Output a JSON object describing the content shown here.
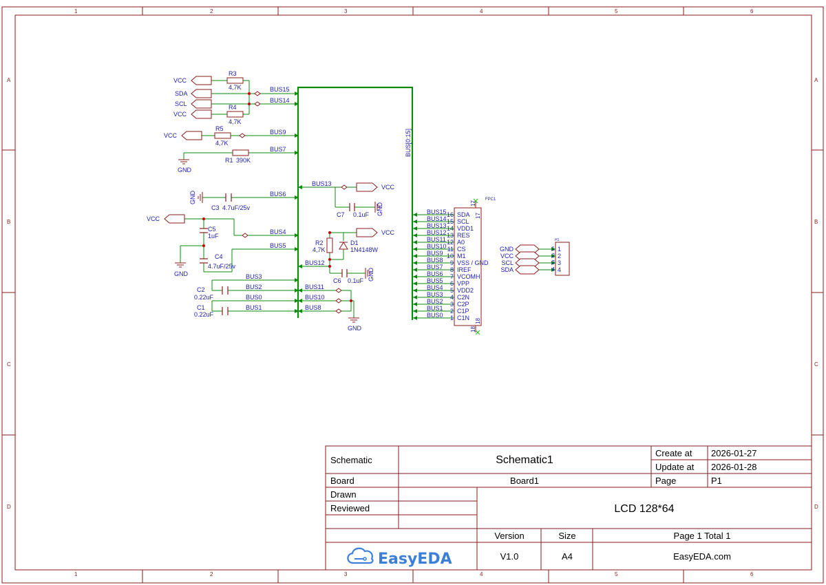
{
  "colors": {
    "border": "#8b1a1a",
    "wire": "#0a8a0a",
    "component": "#8b1a1a",
    "text": "#1c1cb0",
    "junction": "#c00000",
    "logo": "#3c7fd8"
  },
  "frame": {
    "columns": [
      "1",
      "2",
      "3",
      "4",
      "5",
      "6"
    ],
    "rows": [
      "A",
      "B",
      "C",
      "D"
    ]
  },
  "bus": {
    "label": "BUS[0:15]"
  },
  "left_circuit": {
    "ports": {
      "vcc_r3": "VCC",
      "sda": "SDA",
      "scl": "SCL",
      "vcc_r4": "VCC",
      "vcc_r5": "VCC",
      "gnd_r1": "GND",
      "gnd_c3": "GND",
      "vcc_c5": "VCC",
      "gnd_c5": "GND",
      "gnd_c1": "GND"
    },
    "components": {
      "r3": {
        "ref": "R3",
        "value": "4,7K"
      },
      "r4": {
        "ref": "R4",
        "value": "4,7K"
      },
      "r5": {
        "ref": "R5",
        "value": "4,7K"
      },
      "r1": {
        "ref": "R1",
        "value": "390K"
      },
      "c3": {
        "ref": "C3",
        "value": "4.7uF/25v"
      },
      "c5": {
        "ref": "C5",
        "value": "1uF"
      },
      "c4": {
        "ref": "C4",
        "value": "4.7uF/25v"
      },
      "c2": {
        "ref": "C2",
        "value": "0.22uF"
      },
      "c1": {
        "ref": "C1",
        "value": "0.22uF"
      }
    },
    "nets": {
      "bus15": "BUS15",
      "bus14": "BUS14",
      "bus9": "BUS9",
      "bus7": "BUS7",
      "bus6": "BUS6",
      "bus4": "BUS4",
      "bus5": "BUS5",
      "bus3": "BUS3",
      "bus2": "BUS2",
      "bus0": "BUS0",
      "bus1": "BUS1"
    }
  },
  "middle_circuit": {
    "ports": {
      "vcc_bus13": "VCC",
      "gnd_c7": "GND",
      "vcc_d1": "VCC",
      "gnd_c6": "GND",
      "gnd_bottom": "GND"
    },
    "components": {
      "c7": {
        "ref": "C7",
        "value": "0.1uF"
      },
      "r2": {
        "ref": "R2",
        "value": "4,7K"
      },
      "d1": {
        "ref": "D1",
        "value": "1N4148W"
      },
      "c6": {
        "ref": "C6",
        "value": "0.1uF"
      }
    },
    "nets": {
      "bus13": "BUS13",
      "bus12": "BUS12",
      "bus11": "BUS11",
      "bus10": "BUS10",
      "bus8": "BUS8"
    }
  },
  "fpc": {
    "ref": "FPC1",
    "top_pin_left": "17",
    "top_pin_right": "17",
    "bottom_pin_left": "18",
    "bottom_pin_right": "18",
    "pins": [
      {
        "bus": "BUS15",
        "num": "16",
        "name": "SDA"
      },
      {
        "bus": "BUS14",
        "num": "15",
        "name": "SCL"
      },
      {
        "bus": "BUS13",
        "num": "14",
        "name": "VDD1"
      },
      {
        "bus": "BUS12",
        "num": "13",
        "name": "RES"
      },
      {
        "bus": "BUS11",
        "num": "12",
        "name": "A0"
      },
      {
        "bus": "BUS10",
        "num": "11",
        "name": "CS"
      },
      {
        "bus": "BUS9",
        "num": "10",
        "name": "M1"
      },
      {
        "bus": "BUS8",
        "num": "9",
        "name": "VSS / GND"
      },
      {
        "bus": "BUS7",
        "num": "8",
        "name": "IREF"
      },
      {
        "bus": "BUS6",
        "num": "7",
        "name": "VCOMH"
      },
      {
        "bus": "BUS5",
        "num": "6",
        "name": "VPP"
      },
      {
        "bus": "BUS4",
        "num": "5",
        "name": "VDD2"
      },
      {
        "bus": "BUS3",
        "num": "4",
        "name": "C2N"
      },
      {
        "bus": "BUS2",
        "num": "3",
        "name": "C2P"
      },
      {
        "bus": "BUS1",
        "num": "2",
        "name": "C1P"
      },
      {
        "bus": "BUS0",
        "num": "1",
        "name": "C1N"
      }
    ]
  },
  "header_h1": {
    "ref": "H1",
    "pins": [
      {
        "net": "GND",
        "num": "1",
        "label": "1"
      },
      {
        "net": "VCC",
        "num": "2",
        "label": "2"
      },
      {
        "net": "SCL",
        "num": "3",
        "label": "3"
      },
      {
        "net": "SDA",
        "num": "4",
        "label": "4"
      }
    ]
  },
  "title_block": {
    "schematic_label": "Schematic",
    "schematic_name": "Schematic1",
    "create_label": "Create at",
    "create_date": "2026-01-27",
    "update_label": "Update at",
    "update_date": "2026-01-28",
    "board_label": "Board",
    "board_name": "Board1",
    "page_label": "Page",
    "page_value": "P1",
    "drawn_label": "Drawn",
    "reviewed_label": "Reviewed",
    "title": "LCD 128*64",
    "version_label": "Version",
    "size_label": "Size",
    "page_total": "Page  1  Total  1",
    "logo_text": "EasyEDA",
    "version": "V1.0",
    "size": "A4",
    "website": "EasyEDA.com"
  }
}
